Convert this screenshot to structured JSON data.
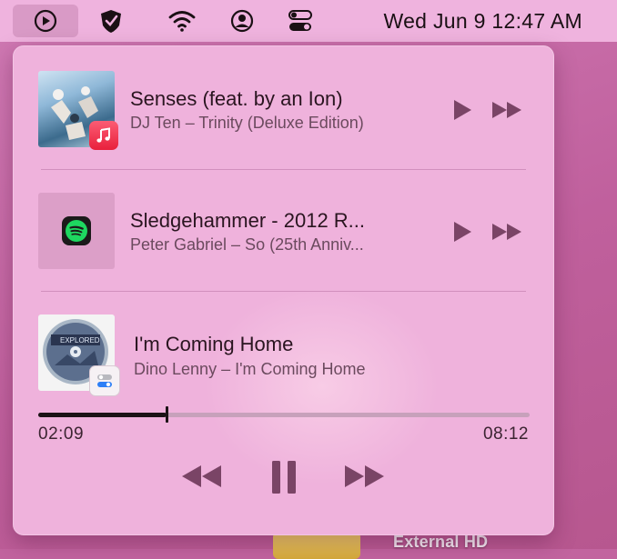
{
  "menubar": {
    "datetime": "Wed Jun 9  12:47 AM"
  },
  "desktop": {
    "label": "External HD"
  },
  "now_playing": [
    {
      "title": "Senses (feat. by an Ion)",
      "subtitle": "DJ Ten – Trinity (Deluxe Edition)",
      "source_icon": "music-app-icon",
      "play_label": "Play",
      "next_label": "Next"
    },
    {
      "title": "Sledgehammer - 2012 R...",
      "subtitle": "Peter Gabriel – So (25th Anniv...",
      "source_icon": "spotify-icon",
      "play_label": "Play",
      "next_label": "Next"
    },
    {
      "title": "I'm Coming Home",
      "subtitle": "Dino Lenny – I'm Coming Home",
      "source_icon": "control-center-icon",
      "elapsed": "02:09",
      "duration": "08:12",
      "progress_fraction": 0.262
    }
  ],
  "colors": {
    "panel_bg": "#efb2dc",
    "menubar_bg": "#efb3de",
    "accent_dark": "#1c1216",
    "music_red": "#f0314c",
    "spotify_green": "#1ed760"
  }
}
